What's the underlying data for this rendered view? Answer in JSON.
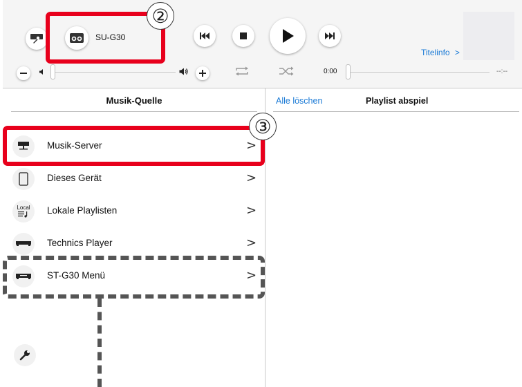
{
  "toolbar": {
    "device_name": "SU-G30",
    "titelinfo": "Titelinfo",
    "titelinfo_chevron": ">",
    "time_elapsed": "0:00",
    "time_total": "--:--"
  },
  "left_panel": {
    "title": "Musik-Quelle",
    "items": [
      {
        "label": "Musik-Server",
        "chevron": ">",
        "icon": "server-icon"
      },
      {
        "label": "Dieses Gerät",
        "chevron": ">",
        "icon": "tablet-icon"
      },
      {
        "label": "Lokale Playlisten",
        "chevron": ">",
        "icon": "local-playlist-icon",
        "icon_text": "Local"
      },
      {
        "label": "Technics Player",
        "chevron": ">",
        "icon": "player-device-icon"
      },
      {
        "label": "ST-G30 Menü",
        "chevron": ">",
        "icon": "tuner-device-icon"
      }
    ]
  },
  "right_panel": {
    "clear_all": "Alle löschen",
    "title": "Playlist abspiel"
  },
  "callouts": {
    "two": "②",
    "three": "③"
  },
  "colors": {
    "accent_blue": "#1c7bd6",
    "highlight_red": "#e8001c",
    "dash_gray": "#555555"
  }
}
